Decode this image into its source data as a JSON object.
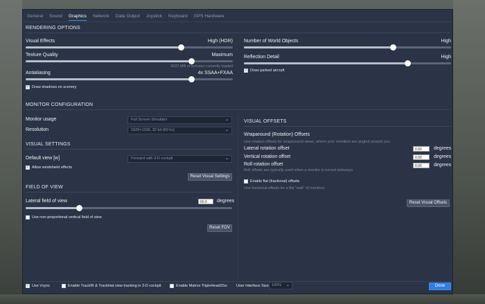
{
  "tabs": [
    "General",
    "Sound",
    "Graphics",
    "Network",
    "Data Output",
    "Joystick",
    "Keyboard",
    "GPS Hardware"
  ],
  "active_tab": "Graphics",
  "rendering": {
    "title": "RENDERING OPTIONS",
    "visual_effects": {
      "label": "Visual Effects",
      "value": "High (HDR)",
      "level": 0.8
    },
    "texture_quality": {
      "label": "Texture Quality",
      "value": "Maximum",
      "level": 0.81,
      "note": "3022 MB of textures currently loaded"
    },
    "antialiasing": {
      "label": "Antialiasing",
      "value": "4x SSAA+FXAA",
      "level": 0.8
    },
    "draw_shadows": {
      "label": "Draw shadows on scenery",
      "checked": true
    },
    "world_objects": {
      "label": "Number of World Objects",
      "value": "High",
      "level": 0.77
    },
    "reflection_detail": {
      "label": "Reflection Detail",
      "value": "High",
      "level": 0.8
    },
    "draw_parked": {
      "label": "Draw parked aircraft",
      "checked": true
    }
  },
  "monitor": {
    "title": "MONITOR CONFIGURATION",
    "usage_label": "Monitor usage",
    "usage_value": "Full Screen Simulator",
    "resolution_label": "Resolution",
    "resolution_value": "1920×1200, 32 bit (60 hz)"
  },
  "visual_settings": {
    "title": "VISUAL SETTINGS",
    "default_view_label": "Default view [w]",
    "default_view_value": "Forward with 3-D cockpit",
    "windshield": {
      "label": "Allow windshield effects",
      "checked": true
    },
    "reset_label": "Reset Visual Settings"
  },
  "fov": {
    "title": "FIELD OF VIEW",
    "lateral_label": "Lateral field of view",
    "lateral_value": "60.0",
    "unit": "degrees",
    "level": 0.27,
    "nonprop": {
      "label": "Use non-proportional vertical field of view",
      "checked": false
    },
    "reset_label": "Reset FOV"
  },
  "visual_offsets": {
    "title": "VISUAL OFFSETS",
    "wraparound_title": "Wraparound (Rotation) Offsets",
    "wraparound_desc": "Use rotation offsets for wraparound views, where your monitors are angled around you.",
    "lateral_label": "Lateral rotation offset",
    "lateral_value": "0.00",
    "vertical_label": "Vertical rotation offset",
    "vertical_value": "0.00",
    "roll_label": "Roll rotation offset",
    "roll_value": "0.00",
    "roll_desc": "Roll offsets are typically used when a monitor is turned sideways.",
    "unit": "degrees",
    "flat": {
      "label": "Enable flat (fractional) offsets",
      "checked": false
    },
    "flat_desc": "Use fractional offsets for a flat \"wall\" of monitors.",
    "reset_label": "Reset Visual Offsets"
  },
  "footer": {
    "vsync": {
      "label": "Use Vsync",
      "checked": true
    },
    "trackir": {
      "label": "Enable TrackIR & TrackHat view tracking in 3-D cockpit",
      "checked": false
    },
    "matrox": {
      "label": "Enable Matrox TripleHead2Go",
      "checked": false
    },
    "ui_size_label": "User Interface Size",
    "ui_size_value": "100%",
    "done_label": "Done"
  },
  "colors": {
    "accent": "#2f7fe0",
    "panel": "#2a3446"
  }
}
